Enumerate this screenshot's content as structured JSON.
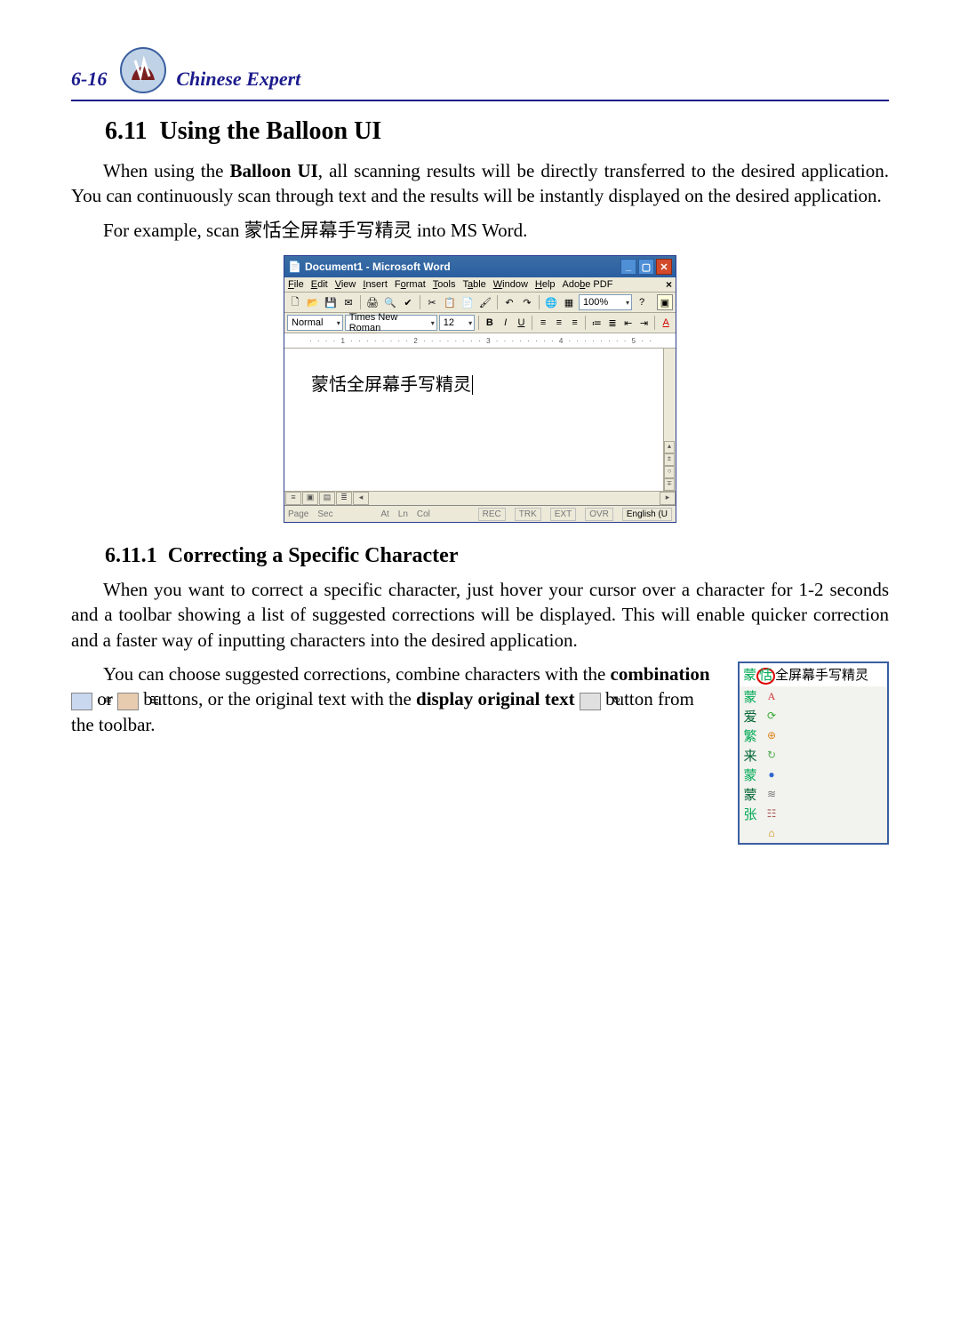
{
  "header": {
    "page_number": "6-16",
    "title": "Chinese Expert"
  },
  "section": {
    "number": "6.11",
    "title": "Using the Balloon UI"
  },
  "para1_a": "When using the ",
  "para1_bold": "Balloon UI",
  "para1_b": ", all scanning results will be directly transferred to the desired application. You can continuously scan through text and the results will be instantly displayed on the desired application.",
  "para2": "For example, scan 蒙恬全屏幕手写精灵 into MS Word.",
  "word": {
    "title": "Document1 - Microsoft Word",
    "menus": [
      "File",
      "Edit",
      "View",
      "Insert",
      "Format",
      "Tools",
      "Table",
      "Window",
      "Help",
      "Adobe PDF"
    ],
    "style": "Normal",
    "font": "Times New Roman",
    "size": "12",
    "zoom": "100%",
    "ruler": "· · · · 1 · · · · · · · · 2 · · · · · · · · 3 · · · · · · · · 4 · · · · · · · · 5 · ·",
    "doc_text": "蒙恬全屏幕手写精灵",
    "status": {
      "page": "Page",
      "sec": "Sec",
      "at": "At",
      "ln": "Ln",
      "col": "Col",
      "rec": "REC",
      "trk": "TRK",
      "ext": "EXT",
      "ovr": "OVR",
      "lang": "English (U"
    }
  },
  "subsection": {
    "number": "6.11.1",
    "title": "Correcting a Specific Character"
  },
  "para3": "When you want to correct a specific character, just hover your cursor over a character for 1-2 seconds and a toolbar showing a list of suggested corrections will be displayed. This will enable quicker correction and a faster way of inputting characters into the desired application.",
  "para4_a": "You can choose suggested corrections, combine characters with the ",
  "para4_bold1": "combination",
  "para4_b": " or ",
  "para4_c": " buttons, or the original text with the ",
  "para4_bold2": "display original text",
  "para4_d": " button from the toolbar.",
  "balloon": {
    "header_pre": "蒙",
    "header_circ": "恬",
    "header_post": "全屏幕手写精灵",
    "candidates": [
      "蒙",
      "爱",
      "繁",
      "来",
      "蒙",
      "蒙",
      "张",
      ""
    ],
    "icons": [
      "A",
      "⟳",
      "⊕",
      "↻",
      "●",
      "≋",
      "☷",
      "⌂"
    ]
  }
}
